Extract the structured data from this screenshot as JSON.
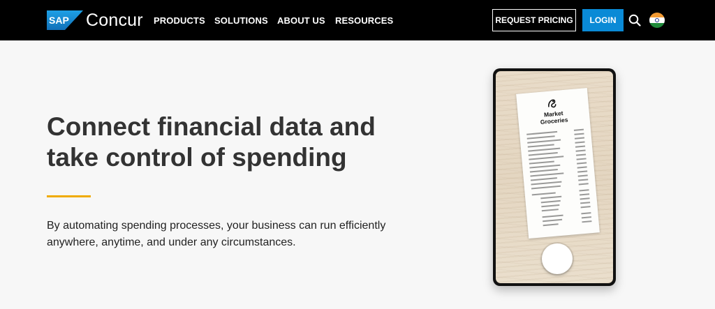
{
  "header": {
    "logo": {
      "badge_text": "SAP",
      "product": "Concur"
    },
    "nav": [
      {
        "label": "PRODUCTS"
      },
      {
        "label": "SOLUTIONS"
      },
      {
        "label": "ABOUT US"
      },
      {
        "label": "RESOURCES"
      }
    ],
    "request_pricing_label": "REQUEST PRICING",
    "login_label": "LOGIN",
    "icons": {
      "search": "search-icon",
      "region": "india-flag-icon"
    },
    "colors": {
      "bar": "#000000",
      "login": "#0a8ad6",
      "sap_blue": "#1a8fdc"
    }
  },
  "hero": {
    "title": "Connect financial data and take control of spending",
    "body": "By automating spending processes, your business can run efficiently anywhere, anytime, and under any circumstances.",
    "accent_color": "#f0ab00"
  },
  "phone": {
    "receipt": {
      "store_line1": "Market",
      "store_line2": "Groceries"
    },
    "shutter_icon": "camera-shutter-icon"
  }
}
